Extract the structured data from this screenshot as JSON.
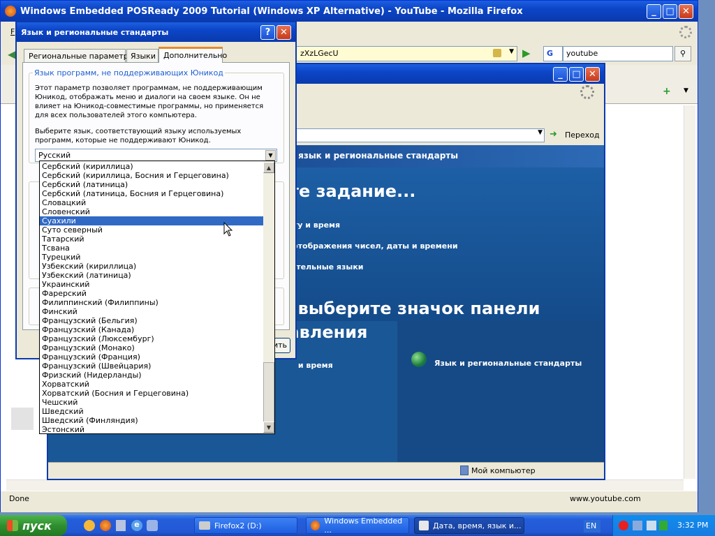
{
  "firefox": {
    "title": "Windows Embedded POSReady 2009 Tutorial (Windows XP Alternative) - YouTube - Mozilla Firefox",
    "url_fragment": "zXzLGecU",
    "search_value": "youtube",
    "search_engine_letter": "G",
    "status_left": "Done",
    "status_right": "www.youtube.com",
    "menu_first_letter": "F"
  },
  "control_panel": {
    "go_label": "Переход",
    "breadcrumb_title": "Дата, время, язык и региональные стандарты",
    "pick_task_heading": "Выберите задание...",
    "tasks": [
      "Изменить дату и время",
      "Изменение формата отображения чисел, даты и времени",
      "Добавить дополнительные языки"
    ],
    "pick_icon_heading_line1": "или выберите значок панели",
    "pick_icon_heading_line2": "управления",
    "icon_items": [
      "Дата и время",
      "Язык и региональные стандарты"
    ],
    "status_my_computer": "Мой компьютер"
  },
  "dialog": {
    "title": "Язык и региональные стандарты",
    "tabs": [
      "Региональные параметры",
      "Языки",
      "Дополнительно"
    ],
    "group_title": "Язык программ, не поддерживающих Юникод",
    "description": "Этот параметр позволяет программам, не поддерживающим Юникод, отображать меню и диалоги на своем языке. Он не влияет на Юникод-совместимые программы, но применяется для всех пользователей этого компьютера.",
    "select_prompt": "Выберите язык, соответствующий языку используемых программ, которые не поддерживают Юникод.",
    "selected_language": "Русский",
    "partial_button_label": "ить",
    "list": [
      "Сербский (кириллица)",
      "Сербский (кириллица, Босния и Герцеговина)",
      "Сербский (латиница)",
      "Сербский (латиница, Босния и Герцеговина)",
      "Словацкий",
      "Словенский",
      "Суахили",
      "Суто северный",
      "Татарский",
      "Тсвана",
      "Турецкий",
      "Узбекский (кириллица)",
      "Узбекский (латиница)",
      "Украинский",
      "Фарерский",
      "Филиппинский (Филиппины)",
      "Финский",
      "Французский (Бельгия)",
      "Французский (Канада)",
      "Французский (Люксембург)",
      "Французский (Монако)",
      "Французский (Франция)",
      "Французский (Швейцария)",
      "Фризский (Нидерланды)",
      "Хорватский",
      "Хорватский (Босния и Герцеговина)",
      "Чешский",
      "Шведский",
      "Шведский (Финляндия)",
      "Эстонский"
    ],
    "selected_index": 6
  },
  "taskbar": {
    "start_label": "пуск",
    "buttons": [
      "Firefox2 (D:)",
      "Windows Embedded ...",
      "Дата, время, язык и..."
    ],
    "lang": "EN",
    "clock": "3:32 PM"
  },
  "colors": {
    "xp_blue": "#0a3aad",
    "selection": "#316ac5",
    "cp_blue": "#1f5d9c"
  }
}
